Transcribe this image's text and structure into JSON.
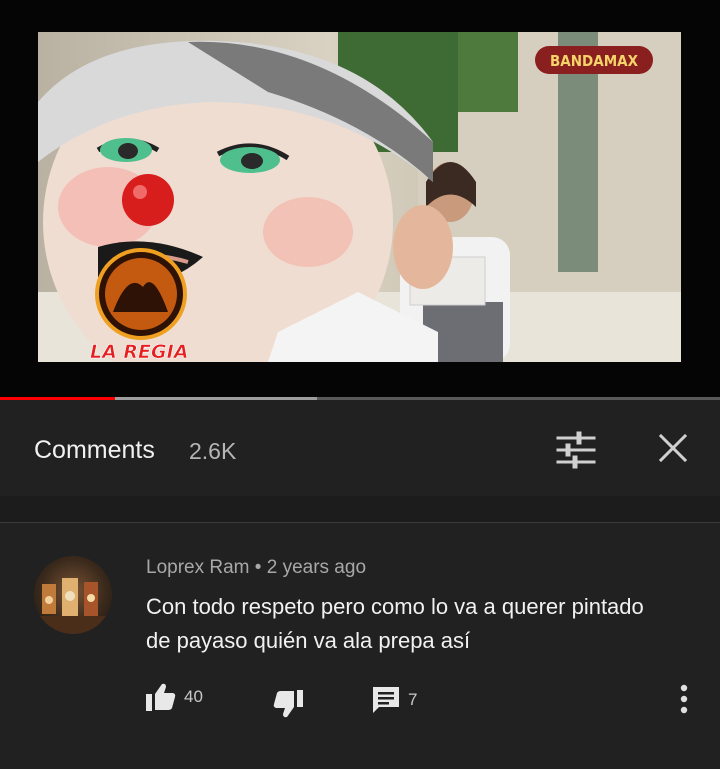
{
  "video": {
    "channel_watermark": "BANDAMAX",
    "show_logo": "LA REGIA",
    "progress_fraction": 0.16,
    "buffer_fraction": 0.44
  },
  "comments_panel": {
    "title": "Comments",
    "count": "2.6K",
    "sort_icon": "sort-sliders-icon",
    "close_icon": "close-x-icon"
  },
  "comment": {
    "author": "Loprex Ram",
    "separator": "•",
    "time": "2 years ago",
    "text": "Con todo respeto pero como lo va a querer pintado  de payaso  quién va ala prepa así",
    "likes": "40",
    "replies": "7",
    "icons": {
      "like": "thumbs-up-icon",
      "dislike": "thumbs-down-icon",
      "reply": "comment-icon",
      "more": "more-vertical-icon"
    }
  },
  "colors": {
    "background": "#212121",
    "progress_played": "#ff0000",
    "text_primary": "#f1f1f1",
    "text_secondary": "#a8a8a8"
  }
}
